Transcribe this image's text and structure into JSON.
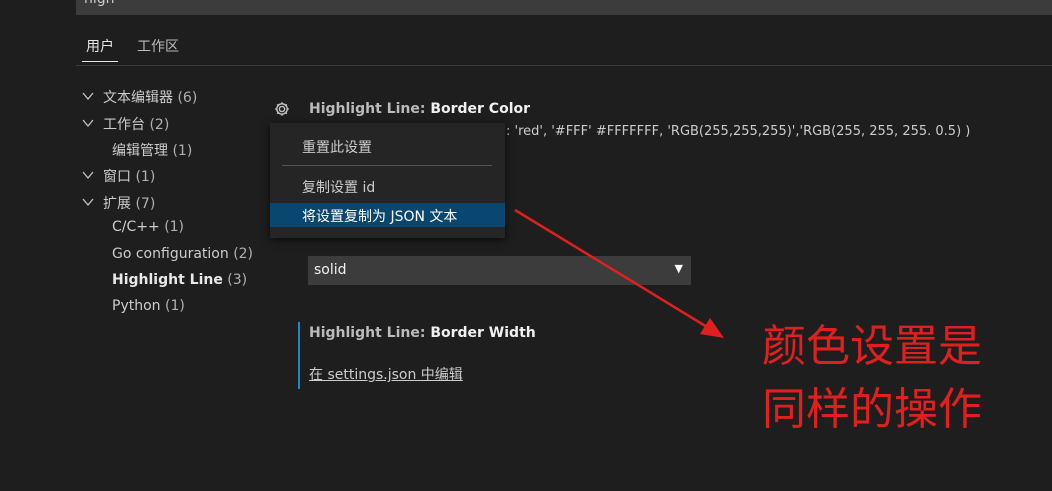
{
  "search": {
    "value": "high"
  },
  "tabs": [
    {
      "label": "用户",
      "active": true
    },
    {
      "label": "工作区",
      "active": false
    }
  ],
  "tree": [
    {
      "label": "文本编辑器",
      "count": "(6)",
      "chevron": "down",
      "bold": false
    },
    {
      "label": "工作台",
      "count": "(2)",
      "chevron": "down",
      "bold": false
    },
    {
      "label": "编辑管理",
      "count": "(1)",
      "chevron": "none",
      "bold": false
    },
    {
      "label": "窗口",
      "count": "(1)",
      "chevron": "down",
      "bold": false
    },
    {
      "label": "扩展",
      "count": "(7)",
      "chevron": "down",
      "bold": false
    },
    {
      "label": "C/C++",
      "count": "(1)",
      "chevron": "none",
      "bold": false
    },
    {
      "label": "Go configuration",
      "count": "(2)",
      "chevron": "none",
      "bold": false
    },
    {
      "label": "Highlight Line",
      "count": "(3)",
      "chevron": "none",
      "bold": true
    },
    {
      "label": "Python",
      "count": "(1)",
      "chevron": "none",
      "bold": false
    }
  ],
  "settings": {
    "border_color": {
      "category": "Highlight Line: ",
      "name": "Border Color",
      "description": ": 'red', '#FFF' #FFFFFFF, 'RGB(255,255,255)','RGB(255, 255, 255. 0.5) )"
    },
    "border_style": {
      "value": "solid"
    },
    "border_width": {
      "category": "Highlight Line: ",
      "name": "Border Width",
      "edit_link": "在 settings.json 中编辑"
    }
  },
  "context_menu": {
    "items": [
      {
        "label": "重置此设置",
        "selected": false
      },
      {
        "label": "复制设置 id",
        "selected": false
      },
      {
        "label": "将设置复制为 JSON 文本",
        "selected": true
      }
    ]
  },
  "annotation": {
    "line1": "颜色设置是",
    "line2": "同样的操作",
    "color": "#e0201f"
  },
  "icons": {
    "gear": "gear-icon",
    "chevron": "chevron-down-icon",
    "dropdown": "dropdown-arrow-icon"
  }
}
